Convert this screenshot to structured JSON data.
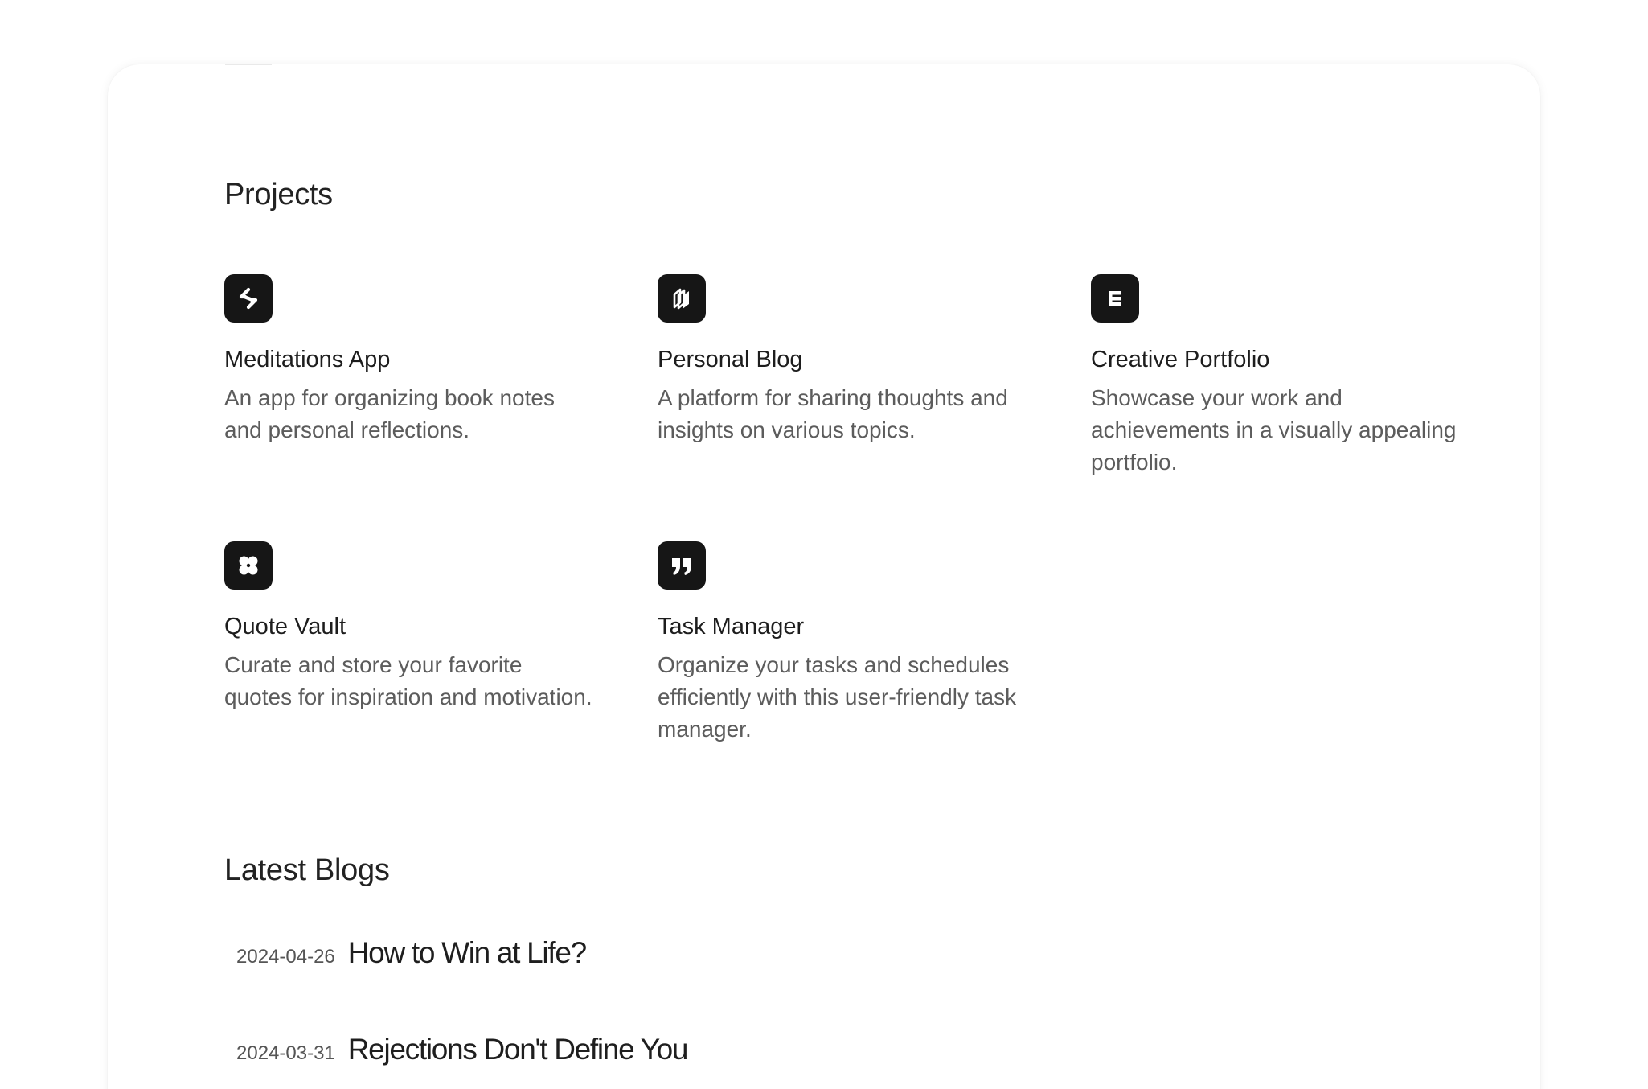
{
  "sections": {
    "projects_title": "Projects",
    "blogs_title": "Latest Blogs"
  },
  "projects": [
    {
      "name": "Meditations App",
      "description": "An app for organizing book notes and personal reflections.",
      "icon": "arrows-swap-icon"
    },
    {
      "name": "Personal Blog",
      "description": "A platform for sharing thoughts and insights on various topics.",
      "icon": "stacked-panels-icon"
    },
    {
      "name": "Creative Portfolio",
      "description": "Showcase your work and achievements in a visually appealing portfolio.",
      "icon": "letter-e-icon"
    },
    {
      "name": "Quote Vault",
      "description": "Curate and store your favorite quotes for inspiration and motivation.",
      "icon": "clover-icon"
    },
    {
      "name": "Task Manager",
      "description": "Organize your tasks and schedules efficiently with this user-friendly task manager.",
      "icon": "quote-marks-icon"
    }
  ],
  "blogs": [
    {
      "date": "2024-04-26",
      "title": "How to Win at Life?"
    },
    {
      "date": "2024-03-31",
      "title": "Rejections Don't Define You"
    }
  ],
  "colors": {
    "icon_background": "#161616",
    "heading_text": "#1d1d1d",
    "description_text": "#5c5c5c"
  }
}
